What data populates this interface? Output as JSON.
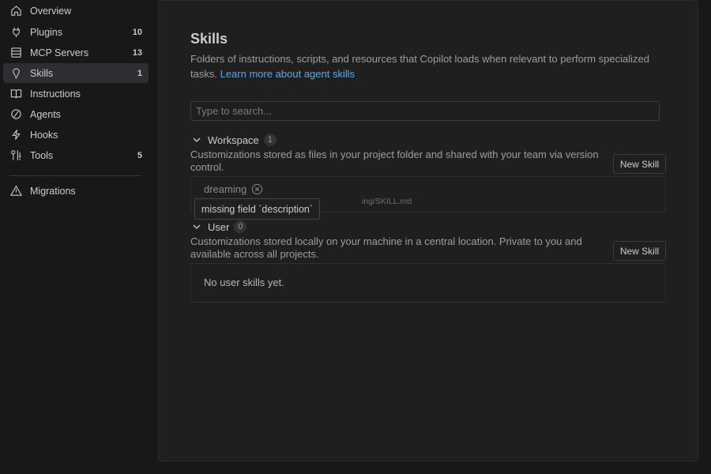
{
  "sidebar": {
    "items": [
      {
        "label": "Overview",
        "count": "",
        "icon": "home-icon"
      },
      {
        "label": "Plugins",
        "count": "10",
        "icon": "plug-icon"
      },
      {
        "label": "MCP Servers",
        "count": "13",
        "icon": "server-icon"
      },
      {
        "label": "Skills",
        "count": "1",
        "icon": "lightbulb-icon",
        "active": true
      },
      {
        "label": "Instructions",
        "count": "",
        "icon": "book-icon"
      },
      {
        "label": "Agents",
        "count": "",
        "icon": "agent-icon"
      },
      {
        "label": "Hooks",
        "count": "",
        "icon": "lightning-icon"
      },
      {
        "label": "Tools",
        "count": "5",
        "icon": "tools-icon"
      }
    ],
    "migrations": {
      "label": "Migrations",
      "icon": "warning-icon"
    }
  },
  "main": {
    "title": "Skills",
    "description": "Folders of instructions, scripts, and resources that Copilot loads when relevant to perform specialized tasks.",
    "learn_more": "Learn more about agent skills",
    "search_placeholder": "Type to search...",
    "workspace": {
      "title": "Workspace",
      "count": "1",
      "description": "Customizations stored as files in your project folder and shared with your team via version control.",
      "button": "New Skill",
      "skill": {
        "name": "dreaming",
        "path_visible": "ing/SKILL.md"
      }
    },
    "tooltip": "missing field `description`",
    "user": {
      "title": "User",
      "count": "0",
      "description": "Customizations stored locally on your machine in a central location. Private to you and available across all projects.",
      "button": "New Skill",
      "empty": "No user skills yet."
    }
  },
  "colors": {
    "accent_link": "#4daafc",
    "active_item_bg": "#2d2e30",
    "background": "#181818"
  }
}
